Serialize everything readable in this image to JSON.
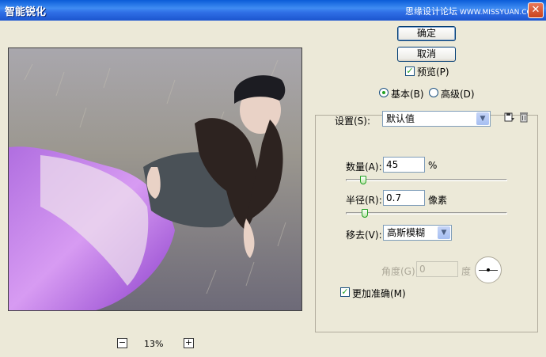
{
  "window": {
    "title": "智能锐化",
    "watermark_text": "思缘设计论坛",
    "watermark_url": "WWW.MISSYUAN.COM",
    "close_glyph": "✕"
  },
  "preview": {
    "zoom_level": "13%",
    "zoom_out_glyph": "−",
    "zoom_in_glyph": "+"
  },
  "buttons": {
    "ok": "确定",
    "cancel": "取消"
  },
  "preview_checkbox": {
    "label": "预览(P)",
    "checked": true
  },
  "mode": {
    "basic": "基本(B)",
    "advanced": "高级(D)",
    "selected": "basic"
  },
  "settings": {
    "label": "设置(S):",
    "value": "默认值",
    "save_icon": "save-icon",
    "delete_icon": "trash-icon"
  },
  "amount": {
    "label": "数量(A):",
    "value": "45",
    "unit": "%",
    "slider_fraction": 0.09
  },
  "radius": {
    "label": "半径(R):",
    "value": "0.7",
    "unit": "像素",
    "slider_fraction": 0.1
  },
  "remove": {
    "label": "移去(V):",
    "value": "高斯模糊"
  },
  "angle": {
    "label": "角度(G):",
    "value": "0",
    "unit": "度"
  },
  "more_accurate": {
    "label": "更加准确(M)",
    "checked": true
  },
  "colors": {
    "titlebar": "#2f6fe6",
    "dialog_bg": "#ece9d8",
    "check_green": "#21a121"
  }
}
